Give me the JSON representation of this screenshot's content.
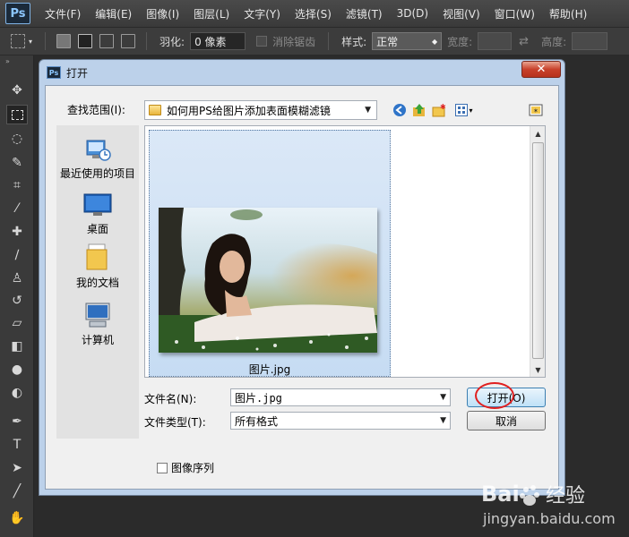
{
  "app": {
    "logo": "Ps",
    "menu": [
      "文件(F)",
      "编辑(E)",
      "图像(I)",
      "图层(L)",
      "文字(Y)",
      "选择(S)",
      "滤镜(T)",
      "3D(D)",
      "视图(V)",
      "窗口(W)",
      "帮助(H)"
    ]
  },
  "options": {
    "feather_label": "羽化:",
    "feather_value": "0 像素",
    "antialias_label": "消除锯齿",
    "style_label": "样式:",
    "style_value": "正常",
    "width_label": "宽度:",
    "height_label": "高度:"
  },
  "dialog": {
    "title": "打开",
    "close_symbol": "✕",
    "lookin_label": "查找范围(I):",
    "lookin_value": "如何用PS给图片添加表面模糊滤镜",
    "places": [
      {
        "label": "最近使用的项目",
        "icon": "recent-items-icon"
      },
      {
        "label": "桌面",
        "icon": "desktop-icon"
      },
      {
        "label": "我的文档",
        "icon": "my-documents-icon"
      },
      {
        "label": "计算机",
        "icon": "computer-icon"
      }
    ],
    "file": {
      "name": "图片.jpg"
    },
    "filename_label": "文件名(N):",
    "filename_value": "图片.jpg",
    "filetype_label": "文件类型(T):",
    "filetype_value": "所有格式",
    "open_button": "打开(O)",
    "cancel_button": "取消",
    "image_sequence_label": "图像序列"
  },
  "watermark": {
    "brand": "经验",
    "url": "jingyan.baidu.com"
  },
  "colors": {
    "dialog_frame": "#bcd1ea",
    "highlight_circle": "#e02020",
    "selection": "#c6dcf3"
  }
}
